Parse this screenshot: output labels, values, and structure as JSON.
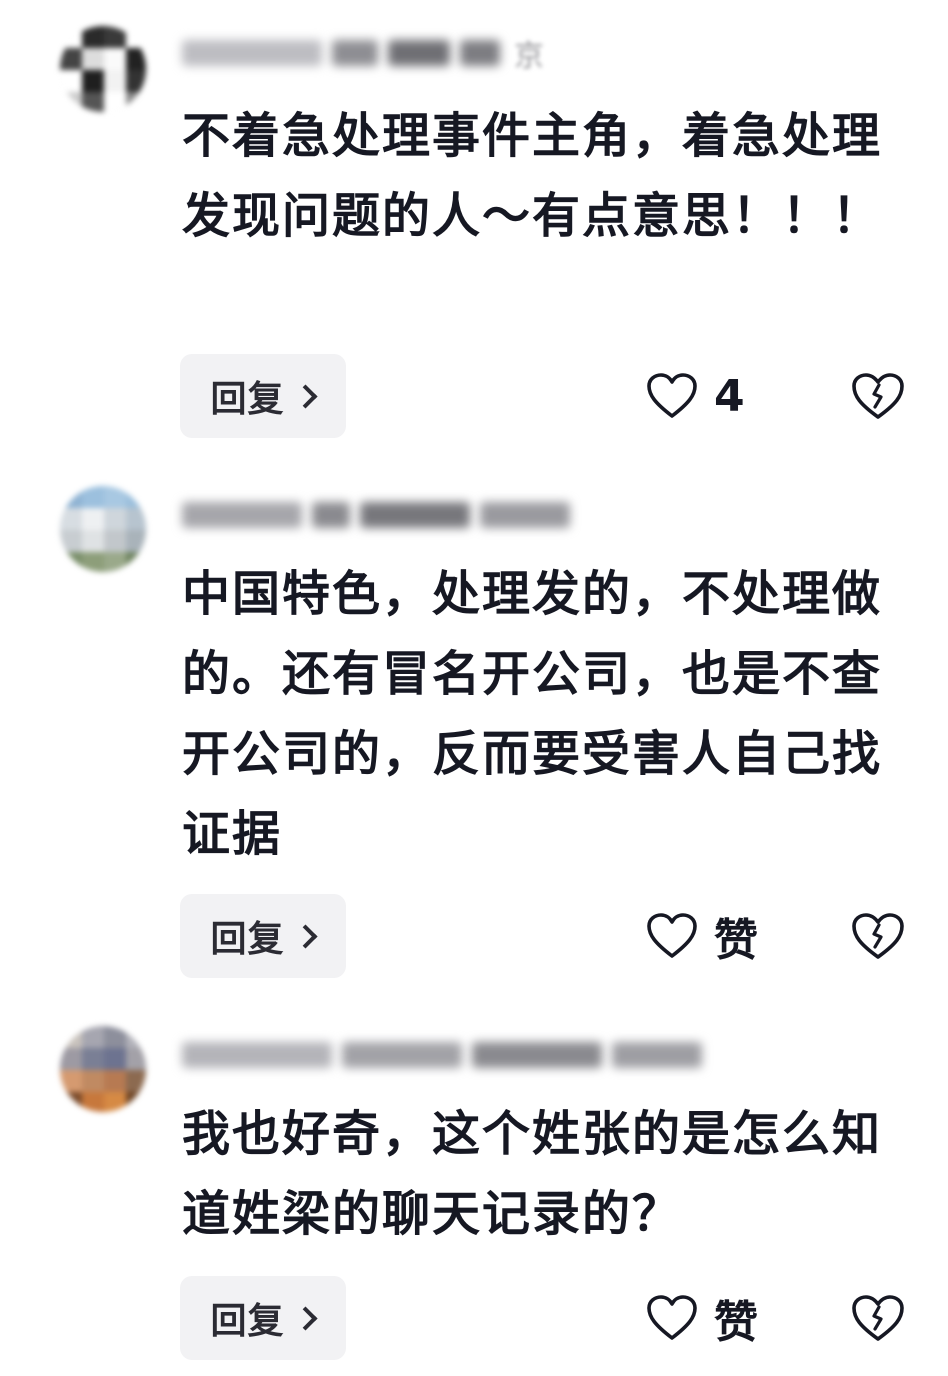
{
  "comments": [
    {
      "username_visible": "京",
      "text": "不着急处理事件主角，着急处理发现问题的人～有点意思！！！",
      "reply_label": "回复",
      "like_display": "4"
    },
    {
      "username_visible": "",
      "text": "中国特色，处理发的，不处理做的。还有冒名开公司，也是不查开公司的，反而要受害人自己找证据",
      "reply_label": "回复",
      "like_display": "赞"
    },
    {
      "username_visible": "",
      "text": "我也好奇，这个姓张的是怎么知道姓梁的聊天记录的？",
      "reply_label": "回复",
      "like_display": "赞"
    }
  ],
  "icons": {
    "like": "heart-outline-icon",
    "dislike": "broken-heart-icon",
    "reply_arrow": "chevron-right-icon"
  },
  "colors": {
    "text": "#161823",
    "reply_bg": "#f2f2f4",
    "username": "#9a9a9e"
  }
}
